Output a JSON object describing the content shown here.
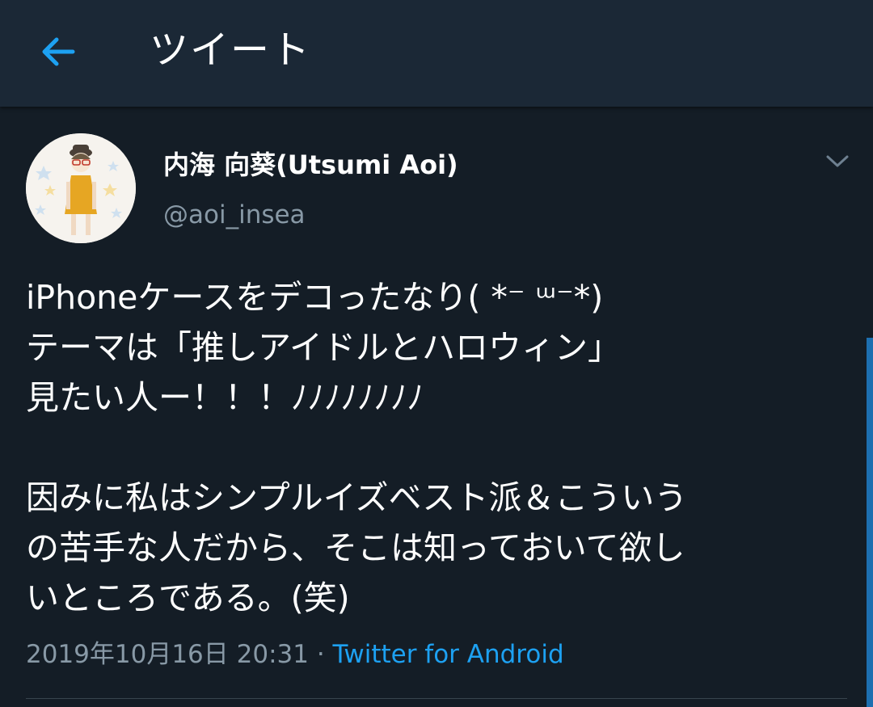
{
  "header": {
    "back_icon": "arrow-left-icon",
    "title": "ツイート"
  },
  "tweet": {
    "author": {
      "display_name": "内海 向葵(Utsumi Aoi)",
      "handle": "@aoi_insea",
      "avatar_icon": "avatar-illustration"
    },
    "menu_icon": "chevron-down-icon",
    "text_lines": [
      "iPhoneケースをデコったなり( *⁻ ᵚ⁻*)",
      "テーマは「推しアイドルとハロウィン」",
      "見たい人ー！！！ﾉﾉﾉﾉﾉﾉﾉﾉ",
      "",
      "因みに私はシンプルイズベスト派＆こういう",
      "の苦手な人だから、そこは知っておいて欲し",
      "いところである。(笑)"
    ],
    "timestamp": "2019年10月16日 20:31",
    "separator": " · ",
    "source": "Twitter for Android"
  },
  "colors": {
    "background": "#141d26",
    "header": "#1b2836",
    "accent": "#1da1f2",
    "secondary_text": "#8899a6"
  }
}
